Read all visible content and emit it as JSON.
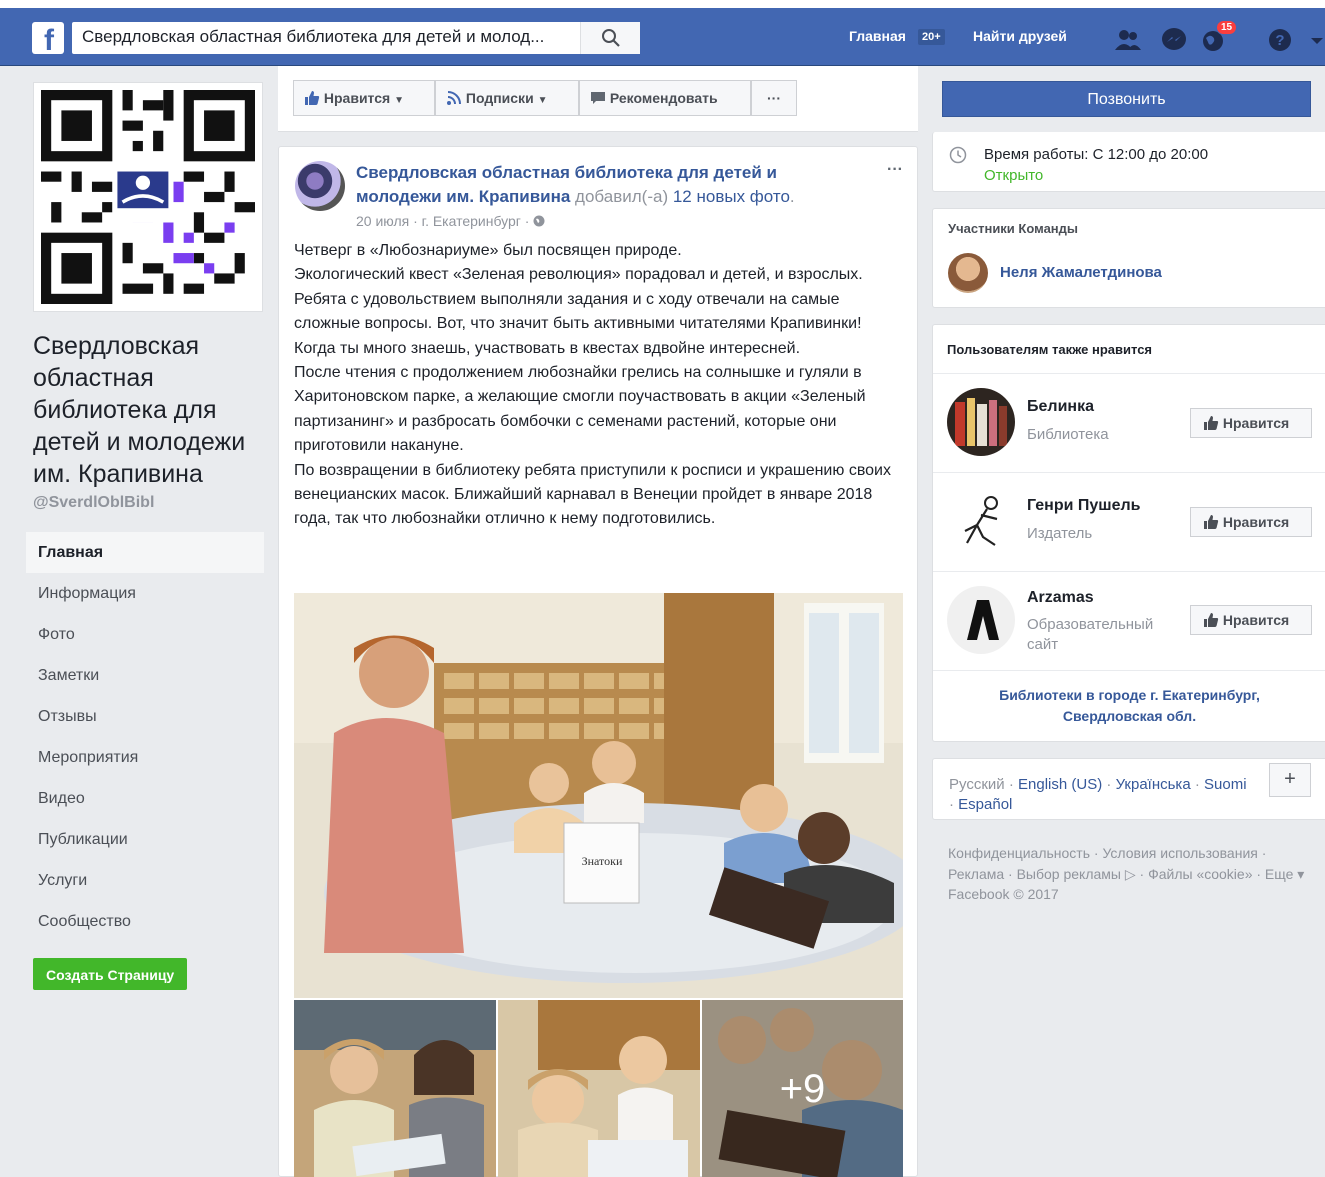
{
  "topbar": {
    "search_value": "Свердловская областная библиотека для детей и молод...",
    "home_label": "Главная",
    "home_badge": "20+",
    "find_friends_label": "Найти друзей",
    "notifications_count": "15"
  },
  "page": {
    "name": "Свердловская областная библиотека для детей и молодежи им. Крапивина",
    "handle": "@SverdlOblBibl"
  },
  "nav": {
    "items": [
      {
        "label": "Главная",
        "active": true
      },
      {
        "label": "Информация"
      },
      {
        "label": "Фото"
      },
      {
        "label": "Заметки"
      },
      {
        "label": "Отзывы"
      },
      {
        "label": "Мероприятия"
      },
      {
        "label": "Видео"
      },
      {
        "label": "Публикации"
      },
      {
        "label": "Услуги"
      },
      {
        "label": "Сообщество"
      }
    ],
    "create_page_label": "Создать Страницу"
  },
  "actions": {
    "like_label": "Нравится",
    "follow_label": "Подписки",
    "recommend_label": "Рекомендовать",
    "more_label": "···",
    "call_label": "Позвонить"
  },
  "post": {
    "author": "Свердловская областная библиотека для детей и молодежи им. Крапивина",
    "action": " добавил(-а) ",
    "photos": "12 новых фото",
    "period": ".",
    "meta": "20 июля · г. Екатеринбург · ",
    "more": "···",
    "body": [
      "Четверг в «Любознариуме» был посвящен природе.",
      "Экологический квест «Зеленая революция» порадовал и детей, и взрослых. Ребята с удовольствием выполняли задания и с ходу отвечали на самые сложные вопросы. Вот, что значит быть активными читателями Крапивинки! Когда ты много знаешь, участвовать в квестах вдвойне интересней.",
      "После чтения с продолжением любознайки грелись на солнышке и гуляли в Харитоновском парке, а желающие смогли поучаствовать в акции «Зеленый партизанинг» и разбросать бомбочки с семенами растений, которые они приготовили накануне.",
      "По возвращении в библиотеку ребята приступили к росписи и украшению своих венецианских масок. Ближайший карнавал в Венеции пройдет в январе 2018 года, так что любознайки отлично к нему подготовились."
    ],
    "photo_sign": "Знатоки",
    "more_photos": "+9"
  },
  "sidebar": {
    "hours_label": "Время работы: С 12:00 до 20:00",
    "open_label": "Открыто",
    "team_title": "Участники Команды",
    "team_member": "Неля Жамалетдинова",
    "also_like_title": "Пользователям также нравится",
    "suggestions": [
      {
        "name": "Белинка",
        "category": "Библиотека",
        "button": "Нравится"
      },
      {
        "name": "Генри Пушель",
        "category": "Издатель",
        "button": "Нравится"
      },
      {
        "name": "Arzamas",
        "category": "Образовательный сайт",
        "button": "Нравится"
      }
    ],
    "libraries_link": "Библиотеки в городе г. Екатеринбург, Свердловская обл."
  },
  "footer": {
    "lang_current": "Русский",
    "lang_links": [
      "English (US)",
      "Українська",
      "Suomi",
      "Español"
    ],
    "lang_add": "+",
    "links": "Конфиденциальность · Условия использования · Реклама · Выбор рекламы ▷ · Файлы «cookie» · Еще ▾",
    "copyright": "Facebook © 2017"
  }
}
